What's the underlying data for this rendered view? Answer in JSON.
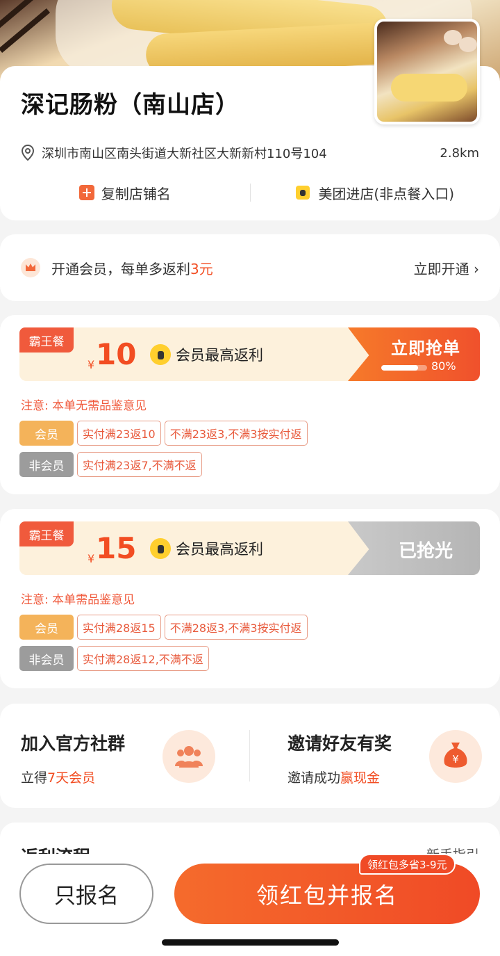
{
  "store": {
    "name": "深记肠粉（南山店）",
    "address": "深圳市南山区南头街道大新社区大新新村110号104",
    "distance": "2.8km",
    "actions": [
      {
        "label": "复制店铺名",
        "icon": "copy-icon"
      },
      {
        "label": "美团进店(非点餐入口)",
        "icon": "meituan-icon"
      }
    ]
  },
  "member": {
    "text_prefix": "开通会员，每单多返利",
    "text_highlight": "3元",
    "link": "立即开通 ›"
  },
  "deals": [
    {
      "badge": "霸王餐",
      "currency": "¥",
      "amount": "10",
      "max_label": "会员最高返利",
      "status": "立即抢单",
      "progress_pct": 80,
      "progress_label": "80%",
      "note": "注意: 本单无需品鉴意见",
      "member_tag": "会员",
      "member_rules": [
        "实付满23返10",
        "不满23返3,不满3按实付返"
      ],
      "nonmember_tag": "非会员",
      "nonmember_rules": [
        "实付满23返7,不满不返"
      ]
    },
    {
      "badge": "霸王餐",
      "currency": "¥",
      "amount": "15",
      "max_label": "会员最高返利",
      "status": "已抢光",
      "note": "注意: 本单需品鉴意见",
      "member_tag": "会员",
      "member_rules": [
        "实付满28返15",
        "不满28返3,不满3按实付返"
      ],
      "nonmember_tag": "非会员",
      "nonmember_rules": [
        "实付满28返12,不满不返"
      ]
    }
  ],
  "promos": {
    "community": {
      "title": "加入官方社群",
      "sub_prefix": "立得",
      "sub_highlight": "7天会员",
      "icon": "group-icon"
    },
    "invite": {
      "title": "邀请好友有奖",
      "sub_prefix": "邀请成功",
      "sub_highlight": "赢现金",
      "icon": "money-bag-icon"
    }
  },
  "flow": {
    "title": "返利流程",
    "guide": "新手指引"
  },
  "bottom": {
    "only_signup": "只报名",
    "main": "领红包并报名",
    "coupon_badge": "领红包多省3-9元"
  },
  "colors": {
    "accent": "#f24d22",
    "orange": "#f56b2c",
    "member_tag": "#f4b35a",
    "nonmember_tag": "#9c9c9c"
  }
}
